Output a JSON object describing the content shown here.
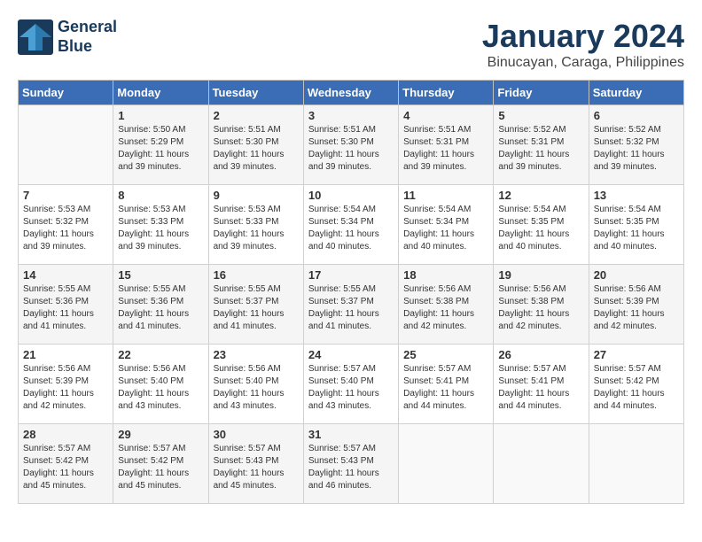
{
  "header": {
    "logo_line1": "General",
    "logo_line2": "Blue",
    "month": "January 2024",
    "location": "Binucayan, Caraga, Philippines"
  },
  "days_of_week": [
    "Sunday",
    "Monday",
    "Tuesday",
    "Wednesday",
    "Thursday",
    "Friday",
    "Saturday"
  ],
  "weeks": [
    [
      {
        "day": "",
        "sunrise": "",
        "sunset": "",
        "daylight": ""
      },
      {
        "day": "1",
        "sunrise": "5:50 AM",
        "sunset": "5:29 PM",
        "daylight": "11 hours and 39 minutes."
      },
      {
        "day": "2",
        "sunrise": "5:51 AM",
        "sunset": "5:30 PM",
        "daylight": "11 hours and 39 minutes."
      },
      {
        "day": "3",
        "sunrise": "5:51 AM",
        "sunset": "5:30 PM",
        "daylight": "11 hours and 39 minutes."
      },
      {
        "day": "4",
        "sunrise": "5:51 AM",
        "sunset": "5:31 PM",
        "daylight": "11 hours and 39 minutes."
      },
      {
        "day": "5",
        "sunrise": "5:52 AM",
        "sunset": "5:31 PM",
        "daylight": "11 hours and 39 minutes."
      },
      {
        "day": "6",
        "sunrise": "5:52 AM",
        "sunset": "5:32 PM",
        "daylight": "11 hours and 39 minutes."
      }
    ],
    [
      {
        "day": "7",
        "sunrise": "5:53 AM",
        "sunset": "5:32 PM",
        "daylight": "11 hours and 39 minutes."
      },
      {
        "day": "8",
        "sunrise": "5:53 AM",
        "sunset": "5:33 PM",
        "daylight": "11 hours and 39 minutes."
      },
      {
        "day": "9",
        "sunrise": "5:53 AM",
        "sunset": "5:33 PM",
        "daylight": "11 hours and 39 minutes."
      },
      {
        "day": "10",
        "sunrise": "5:54 AM",
        "sunset": "5:34 PM",
        "daylight": "11 hours and 40 minutes."
      },
      {
        "day": "11",
        "sunrise": "5:54 AM",
        "sunset": "5:34 PM",
        "daylight": "11 hours and 40 minutes."
      },
      {
        "day": "12",
        "sunrise": "5:54 AM",
        "sunset": "5:35 PM",
        "daylight": "11 hours and 40 minutes."
      },
      {
        "day": "13",
        "sunrise": "5:54 AM",
        "sunset": "5:35 PM",
        "daylight": "11 hours and 40 minutes."
      }
    ],
    [
      {
        "day": "14",
        "sunrise": "5:55 AM",
        "sunset": "5:36 PM",
        "daylight": "11 hours and 41 minutes."
      },
      {
        "day": "15",
        "sunrise": "5:55 AM",
        "sunset": "5:36 PM",
        "daylight": "11 hours and 41 minutes."
      },
      {
        "day": "16",
        "sunrise": "5:55 AM",
        "sunset": "5:37 PM",
        "daylight": "11 hours and 41 minutes."
      },
      {
        "day": "17",
        "sunrise": "5:55 AM",
        "sunset": "5:37 PM",
        "daylight": "11 hours and 41 minutes."
      },
      {
        "day": "18",
        "sunrise": "5:56 AM",
        "sunset": "5:38 PM",
        "daylight": "11 hours and 42 minutes."
      },
      {
        "day": "19",
        "sunrise": "5:56 AM",
        "sunset": "5:38 PM",
        "daylight": "11 hours and 42 minutes."
      },
      {
        "day": "20",
        "sunrise": "5:56 AM",
        "sunset": "5:39 PM",
        "daylight": "11 hours and 42 minutes."
      }
    ],
    [
      {
        "day": "21",
        "sunrise": "5:56 AM",
        "sunset": "5:39 PM",
        "daylight": "11 hours and 42 minutes."
      },
      {
        "day": "22",
        "sunrise": "5:56 AM",
        "sunset": "5:40 PM",
        "daylight": "11 hours and 43 minutes."
      },
      {
        "day": "23",
        "sunrise": "5:56 AM",
        "sunset": "5:40 PM",
        "daylight": "11 hours and 43 minutes."
      },
      {
        "day": "24",
        "sunrise": "5:57 AM",
        "sunset": "5:40 PM",
        "daylight": "11 hours and 43 minutes."
      },
      {
        "day": "25",
        "sunrise": "5:57 AM",
        "sunset": "5:41 PM",
        "daylight": "11 hours and 44 minutes."
      },
      {
        "day": "26",
        "sunrise": "5:57 AM",
        "sunset": "5:41 PM",
        "daylight": "11 hours and 44 minutes."
      },
      {
        "day": "27",
        "sunrise": "5:57 AM",
        "sunset": "5:42 PM",
        "daylight": "11 hours and 44 minutes."
      }
    ],
    [
      {
        "day": "28",
        "sunrise": "5:57 AM",
        "sunset": "5:42 PM",
        "daylight": "11 hours and 45 minutes."
      },
      {
        "day": "29",
        "sunrise": "5:57 AM",
        "sunset": "5:42 PM",
        "daylight": "11 hours and 45 minutes."
      },
      {
        "day": "30",
        "sunrise": "5:57 AM",
        "sunset": "5:43 PM",
        "daylight": "11 hours and 45 minutes."
      },
      {
        "day": "31",
        "sunrise": "5:57 AM",
        "sunset": "5:43 PM",
        "daylight": "11 hours and 46 minutes."
      },
      {
        "day": "",
        "sunrise": "",
        "sunset": "",
        "daylight": ""
      },
      {
        "day": "",
        "sunrise": "",
        "sunset": "",
        "daylight": ""
      },
      {
        "day": "",
        "sunrise": "",
        "sunset": "",
        "daylight": ""
      }
    ]
  ]
}
